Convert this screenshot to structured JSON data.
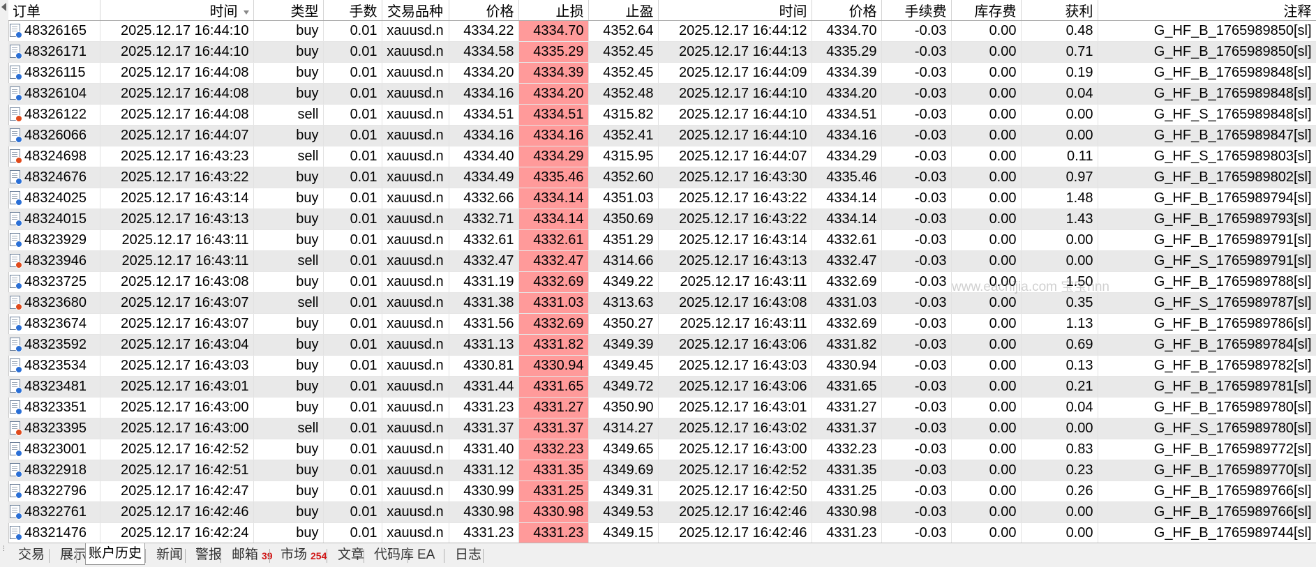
{
  "columns": [
    "订单",
    "时间",
    "类型",
    "手数",
    "交易品种",
    "价格",
    "止损",
    "止盈",
    "时间",
    "价格",
    "手续费",
    "库存费",
    "获利",
    "注释"
  ],
  "rows": [
    {
      "order": "48326165",
      "open_time": "2025.12.17 16:44:10",
      "type": "buy",
      "volume": "0.01",
      "symbol": "xauusd.n",
      "open_price": "4334.22",
      "sl": "4334.70",
      "tp": "4352.64",
      "close_time": "2025.12.17 16:44:12",
      "close_price": "4334.70",
      "commission": "-0.03",
      "swap": "0.00",
      "profit": "0.48",
      "comment": "G_HF_B_1765989850[sl]"
    },
    {
      "order": "48326171",
      "open_time": "2025.12.17 16:44:10",
      "type": "buy",
      "volume": "0.01",
      "symbol": "xauusd.n",
      "open_price": "4334.58",
      "sl": "4335.29",
      "tp": "4352.45",
      "close_time": "2025.12.17 16:44:13",
      "close_price": "4335.29",
      "commission": "-0.03",
      "swap": "0.00",
      "profit": "0.71",
      "comment": "G_HF_B_1765989850[sl]"
    },
    {
      "order": "48326115",
      "open_time": "2025.12.17 16:44:08",
      "type": "buy",
      "volume": "0.01",
      "symbol": "xauusd.n",
      "open_price": "4334.20",
      "sl": "4334.39",
      "tp": "4352.45",
      "close_time": "2025.12.17 16:44:09",
      "close_price": "4334.39",
      "commission": "-0.03",
      "swap": "0.00",
      "profit": "0.19",
      "comment": "G_HF_B_1765989848[sl]"
    },
    {
      "order": "48326104",
      "open_time": "2025.12.17 16:44:08",
      "type": "buy",
      "volume": "0.01",
      "symbol": "xauusd.n",
      "open_price": "4334.16",
      "sl": "4334.20",
      "tp": "4352.48",
      "close_time": "2025.12.17 16:44:10",
      "close_price": "4334.20",
      "commission": "-0.03",
      "swap": "0.00",
      "profit": "0.04",
      "comment": "G_HF_B_1765989848[sl]"
    },
    {
      "order": "48326122",
      "open_time": "2025.12.17 16:44:08",
      "type": "sell",
      "volume": "0.01",
      "symbol": "xauusd.n",
      "open_price": "4334.51",
      "sl": "4334.51",
      "tp": "4315.82",
      "close_time": "2025.12.17 16:44:10",
      "close_price": "4334.51",
      "commission": "-0.03",
      "swap": "0.00",
      "profit": "0.00",
      "comment": "G_HF_S_1765989848[sl]"
    },
    {
      "order": "48326066",
      "open_time": "2025.12.17 16:44:07",
      "type": "buy",
      "volume": "0.01",
      "symbol": "xauusd.n",
      "open_price": "4334.16",
      "sl": "4334.16",
      "tp": "4352.41",
      "close_time": "2025.12.17 16:44:10",
      "close_price": "4334.16",
      "commission": "-0.03",
      "swap": "0.00",
      "profit": "0.00",
      "comment": "G_HF_B_1765989847[sl]"
    },
    {
      "order": "48324698",
      "open_time": "2025.12.17 16:43:23",
      "type": "sell",
      "volume": "0.01",
      "symbol": "xauusd.n",
      "open_price": "4334.40",
      "sl": "4334.29",
      "tp": "4315.95",
      "close_time": "2025.12.17 16:44:07",
      "close_price": "4334.29",
      "commission": "-0.03",
      "swap": "0.00",
      "profit": "0.11",
      "comment": "G_HF_S_1765989803[sl]"
    },
    {
      "order": "48324676",
      "open_time": "2025.12.17 16:43:22",
      "type": "buy",
      "volume": "0.01",
      "symbol": "xauusd.n",
      "open_price": "4334.49",
      "sl": "4335.46",
      "tp": "4352.60",
      "close_time": "2025.12.17 16:43:30",
      "close_price": "4335.46",
      "commission": "-0.03",
      "swap": "0.00",
      "profit": "0.97",
      "comment": "G_HF_B_1765989802[sl]"
    },
    {
      "order": "48324025",
      "open_time": "2025.12.17 16:43:14",
      "type": "buy",
      "volume": "0.01",
      "symbol": "xauusd.n",
      "open_price": "4332.66",
      "sl": "4334.14",
      "tp": "4351.03",
      "close_time": "2025.12.17 16:43:22",
      "close_price": "4334.14",
      "commission": "-0.03",
      "swap": "0.00",
      "profit": "1.48",
      "comment": "G_HF_B_1765989794[sl]"
    },
    {
      "order": "48324015",
      "open_time": "2025.12.17 16:43:13",
      "type": "buy",
      "volume": "0.01",
      "symbol": "xauusd.n",
      "open_price": "4332.71",
      "sl": "4334.14",
      "tp": "4350.69",
      "close_time": "2025.12.17 16:43:22",
      "close_price": "4334.14",
      "commission": "-0.03",
      "swap": "0.00",
      "profit": "1.43",
      "comment": "G_HF_B_1765989793[sl]"
    },
    {
      "order": "48323929",
      "open_time": "2025.12.17 16:43:11",
      "type": "buy",
      "volume": "0.01",
      "symbol": "xauusd.n",
      "open_price": "4332.61",
      "sl": "4332.61",
      "tp": "4351.29",
      "close_time": "2025.12.17 16:43:14",
      "close_price": "4332.61",
      "commission": "-0.03",
      "swap": "0.00",
      "profit": "0.00",
      "comment": "G_HF_B_1765989791[sl]"
    },
    {
      "order": "48323946",
      "open_time": "2025.12.17 16:43:11",
      "type": "sell",
      "volume": "0.01",
      "symbol": "xauusd.n",
      "open_price": "4332.47",
      "sl": "4332.47",
      "tp": "4314.66",
      "close_time": "2025.12.17 16:43:13",
      "close_price": "4332.47",
      "commission": "-0.03",
      "swap": "0.00",
      "profit": "0.00",
      "comment": "G_HF_S_1765989791[sl]"
    },
    {
      "order": "48323725",
      "open_time": "2025.12.17 16:43:08",
      "type": "buy",
      "volume": "0.01",
      "symbol": "xauusd.n",
      "open_price": "4331.19",
      "sl": "4332.69",
      "tp": "4349.22",
      "close_time": "2025.12.17 16:43:11",
      "close_price": "4332.69",
      "commission": "-0.03",
      "swap": "0.00",
      "profit": "1.50",
      "comment": "G_HF_B_1765989788[sl]"
    },
    {
      "order": "48323680",
      "open_time": "2025.12.17 16:43:07",
      "type": "sell",
      "volume": "0.01",
      "symbol": "xauusd.n",
      "open_price": "4331.38",
      "sl": "4331.03",
      "tp": "4313.63",
      "close_time": "2025.12.17 16:43:08",
      "close_price": "4331.03",
      "commission": "-0.03",
      "swap": "0.00",
      "profit": "0.35",
      "comment": "G_HF_S_1765989787[sl]"
    },
    {
      "order": "48323674",
      "open_time": "2025.12.17 16:43:07",
      "type": "buy",
      "volume": "0.01",
      "symbol": "xauusd.n",
      "open_price": "4331.56",
      "sl": "4332.69",
      "tp": "4350.27",
      "close_time": "2025.12.17 16:43:11",
      "close_price": "4332.69",
      "commission": "-0.03",
      "swap": "0.00",
      "profit": "1.13",
      "comment": "G_HF_B_1765989786[sl]"
    },
    {
      "order": "48323592",
      "open_time": "2025.12.17 16:43:04",
      "type": "buy",
      "volume": "0.01",
      "symbol": "xauusd.n",
      "open_price": "4331.13",
      "sl": "4331.82",
      "tp": "4349.39",
      "close_time": "2025.12.17 16:43:06",
      "close_price": "4331.82",
      "commission": "-0.03",
      "swap": "0.00",
      "profit": "0.69",
      "comment": "G_HF_B_1765989784[sl]"
    },
    {
      "order": "48323534",
      "open_time": "2025.12.17 16:43:03",
      "type": "buy",
      "volume": "0.01",
      "symbol": "xauusd.n",
      "open_price": "4330.81",
      "sl": "4330.94",
      "tp": "4349.45",
      "close_time": "2025.12.17 16:43:03",
      "close_price": "4330.94",
      "commission": "-0.03",
      "swap": "0.00",
      "profit": "0.13",
      "comment": "G_HF_B_1765989782[sl]"
    },
    {
      "order": "48323481",
      "open_time": "2025.12.17 16:43:01",
      "type": "buy",
      "volume": "0.01",
      "symbol": "xauusd.n",
      "open_price": "4331.44",
      "sl": "4331.65",
      "tp": "4349.72",
      "close_time": "2025.12.17 16:43:06",
      "close_price": "4331.65",
      "commission": "-0.03",
      "swap": "0.00",
      "profit": "0.21",
      "comment": "G_HF_B_1765989781[sl]"
    },
    {
      "order": "48323351",
      "open_time": "2025.12.17 16:43:00",
      "type": "buy",
      "volume": "0.01",
      "symbol": "xauusd.n",
      "open_price": "4331.23",
      "sl": "4331.27",
      "tp": "4350.90",
      "close_time": "2025.12.17 16:43:01",
      "close_price": "4331.27",
      "commission": "-0.03",
      "swap": "0.00",
      "profit": "0.04",
      "comment": "G_HF_B_1765989780[sl]"
    },
    {
      "order": "48323395",
      "open_time": "2025.12.17 16:43:00",
      "type": "sell",
      "volume": "0.01",
      "symbol": "xauusd.n",
      "open_price": "4331.37",
      "sl": "4331.37",
      "tp": "4314.27",
      "close_time": "2025.12.17 16:43:02",
      "close_price": "4331.37",
      "commission": "-0.03",
      "swap": "0.00",
      "profit": "0.00",
      "comment": "G_HF_S_1765989780[sl]"
    },
    {
      "order": "48323001",
      "open_time": "2025.12.17 16:42:52",
      "type": "buy",
      "volume": "0.01",
      "symbol": "xauusd.n",
      "open_price": "4331.40",
      "sl": "4332.23",
      "tp": "4349.65",
      "close_time": "2025.12.17 16:43:00",
      "close_price": "4332.23",
      "commission": "-0.03",
      "swap": "0.00",
      "profit": "0.83",
      "comment": "G_HF_B_1765989772[sl]"
    },
    {
      "order": "48322918",
      "open_time": "2025.12.17 16:42:51",
      "type": "buy",
      "volume": "0.01",
      "symbol": "xauusd.n",
      "open_price": "4331.12",
      "sl": "4331.35",
      "tp": "4349.69",
      "close_time": "2025.12.17 16:42:52",
      "close_price": "4331.35",
      "commission": "-0.03",
      "swap": "0.00",
      "profit": "0.23",
      "comment": "G_HF_B_1765989770[sl]"
    },
    {
      "order": "48322796",
      "open_time": "2025.12.17 16:42:47",
      "type": "buy",
      "volume": "0.01",
      "symbol": "xauusd.n",
      "open_price": "4330.99",
      "sl": "4331.25",
      "tp": "4349.31",
      "close_time": "2025.12.17 16:42:50",
      "close_price": "4331.25",
      "commission": "-0.03",
      "swap": "0.00",
      "profit": "0.26",
      "comment": "G_HF_B_1765989766[sl]"
    },
    {
      "order": "48322761",
      "open_time": "2025.12.17 16:42:46",
      "type": "buy",
      "volume": "0.01",
      "symbol": "xauusd.n",
      "open_price": "4330.98",
      "sl": "4330.98",
      "tp": "4349.53",
      "close_time": "2025.12.17 16:42:46",
      "close_price": "4330.98",
      "commission": "-0.03",
      "swap": "0.00",
      "profit": "0.00",
      "comment": "G_HF_B_1765989766[sl]"
    },
    {
      "order": "48321476",
      "open_time": "2025.12.17 16:42:24",
      "type": "buy",
      "volume": "0.01",
      "symbol": "xauusd.n",
      "open_price": "4331.23",
      "sl": "4331.23",
      "tp": "4349.15",
      "close_time": "2025.12.17 16:42:46",
      "close_price": "4331.23",
      "commission": "-0.03",
      "swap": "0.00",
      "profit": "0.00",
      "comment": "G_HF_B_1765989744[sl]"
    }
  ],
  "watermark": "www.eachijia.com 宝宝nnn",
  "tabs": [
    {
      "label": "交易",
      "badge": null,
      "active": false
    },
    {
      "label": "展示",
      "badge": null,
      "active": false
    },
    {
      "label": "账户历史",
      "badge": null,
      "active": true
    },
    {
      "label": "新闻",
      "badge": null,
      "active": false
    },
    {
      "label": "警报",
      "badge": null,
      "active": false
    },
    {
      "label": "邮箱",
      "badge": "39",
      "active": false
    },
    {
      "label": "市场",
      "badge": "254",
      "active": false
    },
    {
      "label": "文章",
      "badge": null,
      "active": false
    },
    {
      "label": "代码库",
      "badge": null,
      "active": false
    },
    {
      "label": "EA",
      "badge": null,
      "active": false
    },
    {
      "label": "日志",
      "badge": null,
      "active": false
    }
  ],
  "icons": {
    "order_icon": "order-document-icon",
    "sort_icon": "sort-descending-icon",
    "collapse_icon": "collapse-arrow-icon"
  },
  "colors": {
    "stoploss_bg": "#ff9a9a",
    "buy_dot": "#2a6fd6",
    "sell_dot": "#e04a1c",
    "badge": "#d01818"
  }
}
